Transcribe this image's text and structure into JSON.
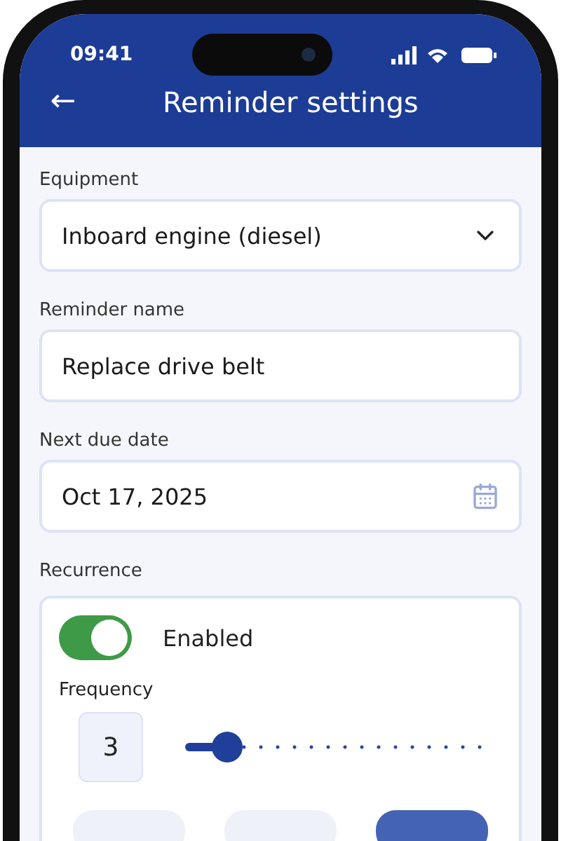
{
  "status_bar": {
    "time": "09:41"
  },
  "header": {
    "back": "←",
    "title": "Reminder settings"
  },
  "equipment": {
    "label": "Equipment",
    "value": "Inboard engine (diesel)"
  },
  "reminder_name": {
    "label": "Reminder name",
    "value": "Replace drive belt"
  },
  "next_due_date": {
    "label": "Next due date",
    "value": "Oct 17, 2025"
  },
  "recurrence": {
    "label": "Recurrence",
    "enabled": true,
    "toggle_label": "Enabled",
    "frequency_label": "Frequency",
    "frequency_value": "3",
    "level": 0.1,
    "units": [
      {
        "selected": false
      },
      {
        "selected": false
      },
      {
        "selected": true
      }
    ]
  }
}
